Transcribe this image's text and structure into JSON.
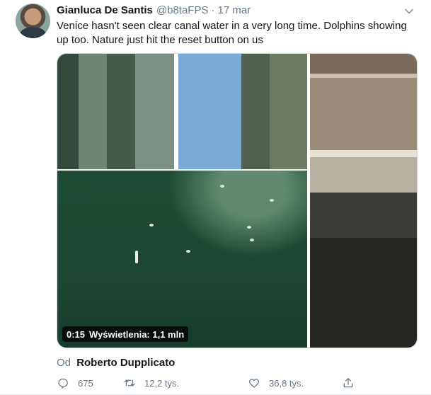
{
  "tweet": {
    "author": {
      "display_name": "Gianluca De Santis",
      "handle": "@b8taFPS",
      "separator": "·",
      "time": "17 mar"
    },
    "text": "Venice hasn't seen clear canal water in a very long time. Dolphins showing up too. Nature just hit the reset button on us",
    "media": {
      "duration": "0:15",
      "views_label": "Wyświetlenia: 1,1 mln"
    },
    "attribution": {
      "prefix": "Od",
      "name": "Roberto Dupplicato"
    },
    "actions": {
      "reply_count": "675",
      "retweet_count": "12,2 tys.",
      "like_count": "36,8 tys."
    },
    "icons": {
      "menu": "chevron-down-icon",
      "reply": "reply-icon",
      "retweet": "retweet-icon",
      "like": "heart-icon",
      "share": "share-icon"
    },
    "colors": {
      "text_primary": "#14171a",
      "text_secondary": "#657786"
    }
  }
}
